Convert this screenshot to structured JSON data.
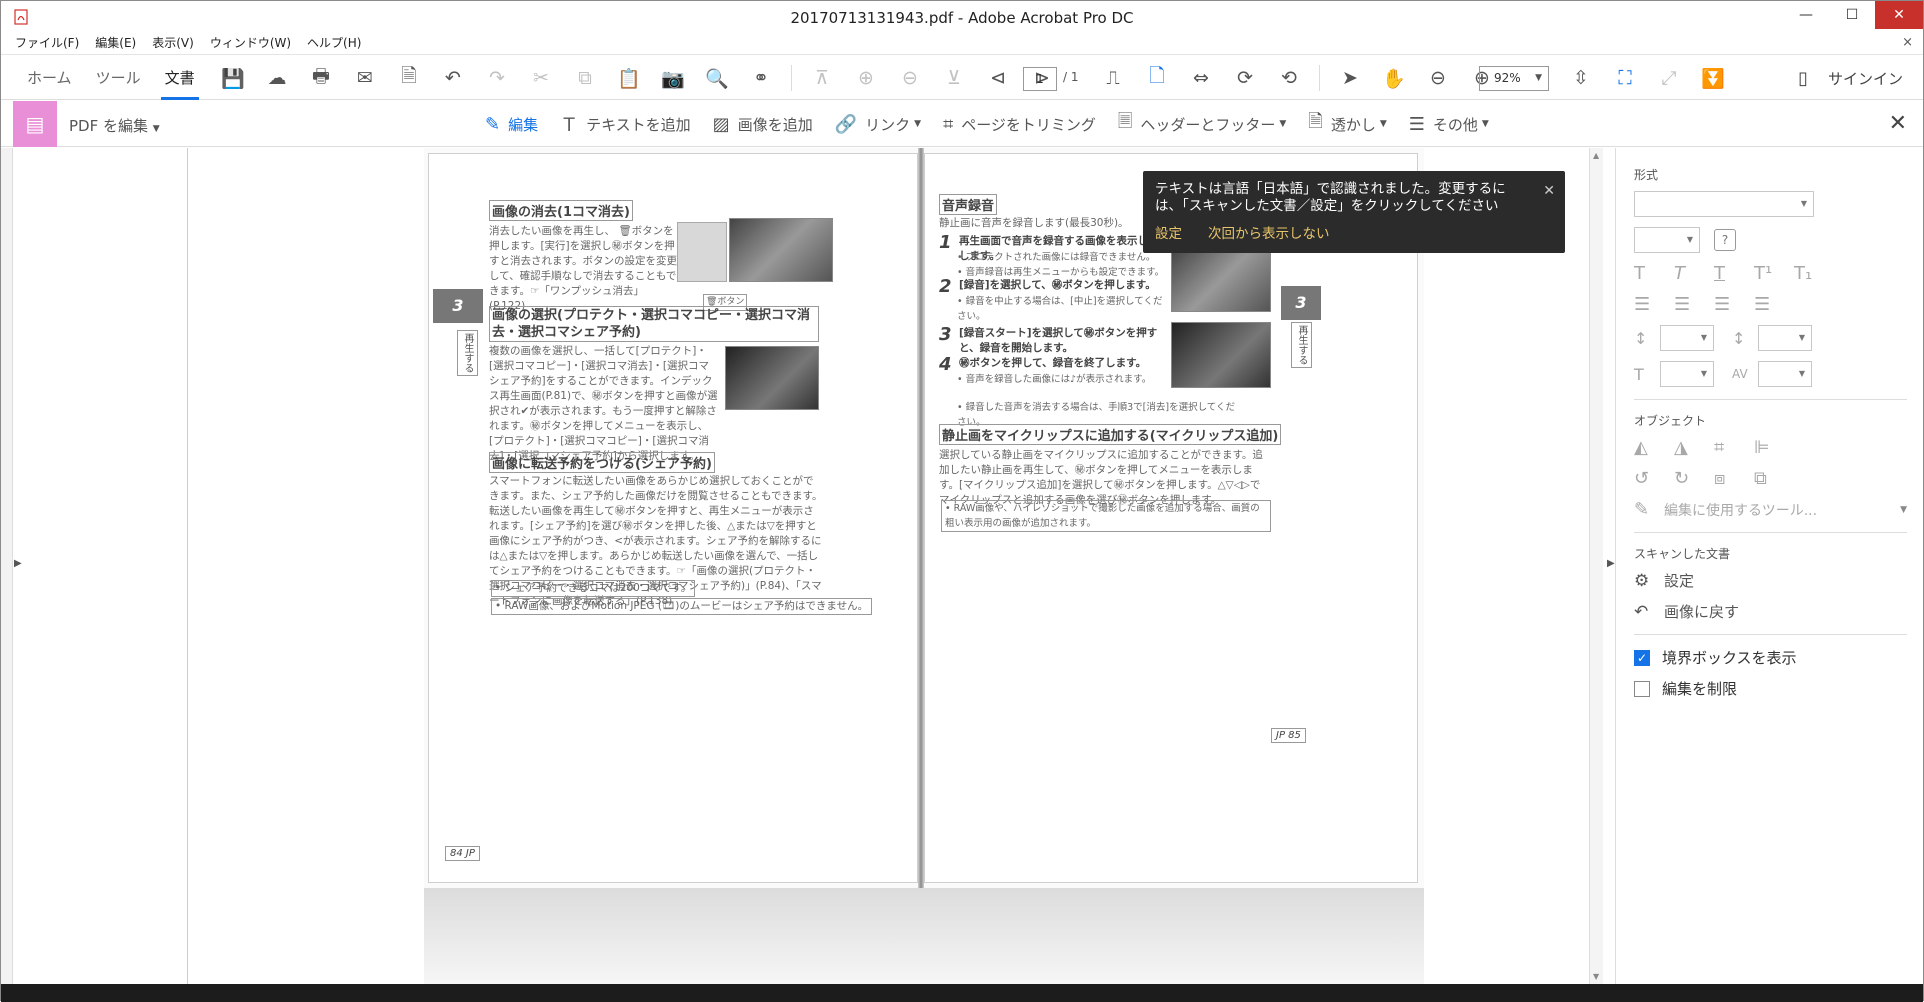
{
  "window": {
    "title": "20170713131943.pdf - Adobe Acrobat Pro DC",
    "minimize": "—",
    "maximize": "☐",
    "close": "✕"
  },
  "menubar": {
    "items": [
      "ファイル(F)",
      "編集(E)",
      "表示(V)",
      "ウィンドウ(W)",
      "ヘルプ(H)"
    ],
    "close": "×"
  },
  "toolbar": {
    "tabs": [
      "ホーム",
      "ツール",
      "文書"
    ],
    "active_tab": "文書",
    "page_current": "1",
    "page_total": "/ 1",
    "zoom": "92%",
    "signin": "サインイン"
  },
  "edit_toolbar": {
    "mode_label": "PDF を編集",
    "items": [
      {
        "label": "編集",
        "icon": "edit-icon"
      },
      {
        "label": "テキストを追加",
        "icon": "text-icon"
      },
      {
        "label": "画像を追加",
        "icon": "image-icon"
      },
      {
        "label": "リンク",
        "icon": "link-icon"
      },
      {
        "label": "ページをトリミング",
        "icon": "crop-icon"
      },
      {
        "label": "ヘッダーとフッター",
        "icon": "header-footer-icon"
      },
      {
        "label": "透かし",
        "icon": "watermark-icon"
      },
      {
        "label": "その他",
        "icon": "more-icon"
      }
    ]
  },
  "toast": {
    "message": "テキストは言語「日本語」で認識されました。変更するには、「スキャンした文書／設定」をクリックしてください",
    "link_settings": "設定",
    "link_dismiss": "次回から表示しない"
  },
  "document": {
    "left": {
      "h1": "画像の消去(1コマ消去)",
      "p1": "消去したい画像を再生し、 🗑ボタンを押します。[実行]を選択し㊙ボタンを押すと消去されます。ボタンの設定を変更して、確認手順なしで消去することもできます。☞「ワンプッシュ消去」(P.122)",
      "button_label": "🗑ボタン",
      "h2": "画像の選択(プロテクト・選択コマコピー・選択コマ消去・選択コマシェア予約)",
      "p2": "複数の画像を選択し、一括して[プロテクト]・[選択コマコピー]・[選択コマ消去]・[選択コマシェア予約]をすることができます。インデックス再生画面(P.81)で、㊙ボタンを押すと画像が選択され✔が表示されます。もう一度押すと解除されます。㊙ボタンを押してメニューを表示し、[プロテクト]・[選択コマコピー]・[選択コマ消去]・[選択コマシェア予約]から選択します。",
      "h3": "画像に転送予約をつける(シェア予約)",
      "p3": "スマートフォンに転送したい画像をあらかじめ選択しておくことができます。また、シェア予約した画像だけを閲覧させることもできます。転送したい画像を再生して㊙ボタンを押すと、再生メニューが表示されます。[シェア予約]を選び㊙ボタンを押した後、△または▽を押すと画像にシェア予約がつき、<が表示されます。シェア予約を解除するには△または▽を押します。あらかじめ転送したい画像を選んで、一括してシェア予約をつけることもできます。☞「画像の選択(プロテクト・選択コマコピー・選択コマ消去・選択コマシェア予約)」(P.84)、「スマートフォンに画像を転送する」(P.138)",
      "note1": "• シェア予約できるコマは200コマです。",
      "note2": "• RAW画像、およびMotion JPEG (🎞)のムービーはシェア予約はできません。",
      "tab_number": "3",
      "tab_text": "再生する",
      "page_number": "84 JP"
    },
    "right": {
      "h1": "音声録音",
      "p1": "静止画に音声を録音します(最長30秒)。",
      "step1_num": "1",
      "step1": "再生画面で音声を録音する画像を表示し、㊙ボタンを押します。",
      "step1_notes": "• プロテクトされた画像には録音できません。\n• 音声録音は再生メニューからも設定できます。",
      "step2_num": "2",
      "step2": "[録音]を選択して、㊙ボタンを押します。",
      "step2_note": "• 録音を中止する場合は、[中止]を選択してください。",
      "step3_num": "3",
      "step3": "[録音スタート]を選択して㊙ボタンを押すと、録音を開始します。",
      "step4_num": "4",
      "step4": "㊙ボタンを押して、録音を終了します。",
      "step4_note1": "• 音声を録音した画像には♪が表示されます。",
      "step4_note2": "• 録音した音声を消去する場合は、手順3で[消去]を選択してください。",
      "h2": "静止画をマイクリップスに追加する(マイクリップス追加)",
      "p2": "選択している静止画をマイクリップスに追加することができます。追加したい静止画を再生して、㊙ボタンを押してメニューを表示します。[マイクリップス追加]を選択して㊙ボタンを押します。△▽◁▷でマイクリップスと追加する画像を選び㊙ボタンを押します。",
      "note": "• RAW画像や、ハイレゾショットで撮影した画像を追加する場合、画質の粗い表示用の画像が追加されます。",
      "tab_number": "3",
      "tab_text": "再生する",
      "page_number": "JP 85"
    }
  },
  "right_panel": {
    "format_title": "形式",
    "object_title": "オブジェクト",
    "edit_tool_label": "編集に使用するツール...",
    "scanned_title": "スキャンした文書",
    "settings": "設定",
    "revert_to_image": "画像に戻す",
    "show_bounding_boxes": "境界ボックスを表示",
    "show_bounding_boxes_checked": true,
    "restrict_editing": "編集を制限",
    "restrict_editing_checked": false
  }
}
